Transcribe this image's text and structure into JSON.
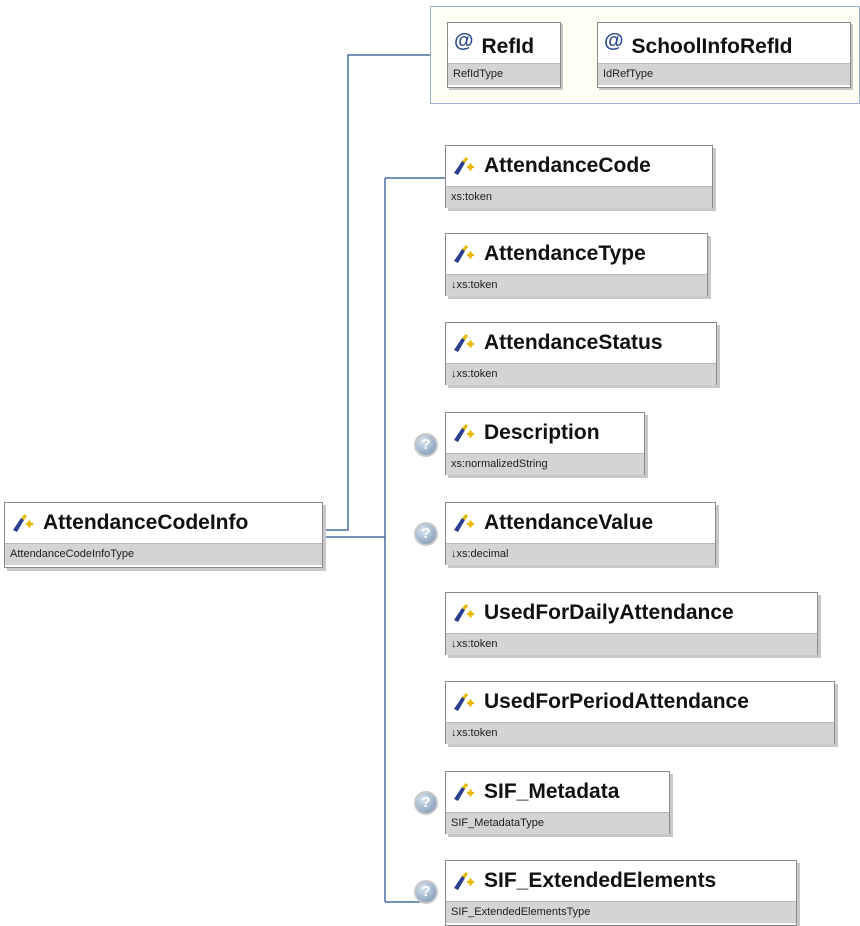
{
  "root": {
    "name": "AttendanceCodeInfo",
    "type": "AttendanceCodeInfoType"
  },
  "attributes": [
    {
      "name": "RefId",
      "type": "RefIdType"
    },
    {
      "name": "SchoolInfoRefId",
      "type": "IdRefType"
    }
  ],
  "elements": [
    {
      "name": "AttendanceCode",
      "type": "xs:token",
      "optional": false
    },
    {
      "name": "AttendanceType",
      "type": "↓xs:token",
      "optional": false
    },
    {
      "name": "AttendanceStatus",
      "type": "↓xs:token",
      "optional": false
    },
    {
      "name": "Description",
      "type": "xs:normalizedString",
      "optional": true
    },
    {
      "name": "AttendanceValue",
      "type": "↓xs:decimal",
      "optional": true
    },
    {
      "name": "UsedForDailyAttendance",
      "type": "↓xs:token",
      "optional": false
    },
    {
      "name": "UsedForPeriodAttendance",
      "type": "↓xs:token",
      "optional": false
    },
    {
      "name": "SIF_Metadata",
      "type": "SIF_MetadataType",
      "optional": true
    },
    {
      "name": "SIF_ExtendedElements",
      "type": "SIF_ExtendedElementsType",
      "optional": true
    }
  ],
  "symbols": {
    "attribute": "@",
    "optional": "?"
  },
  "colors": {
    "connector": "#4a6ea0",
    "type_band": "#d4d4d4",
    "attr_group_border": "#9db3d0"
  }
}
